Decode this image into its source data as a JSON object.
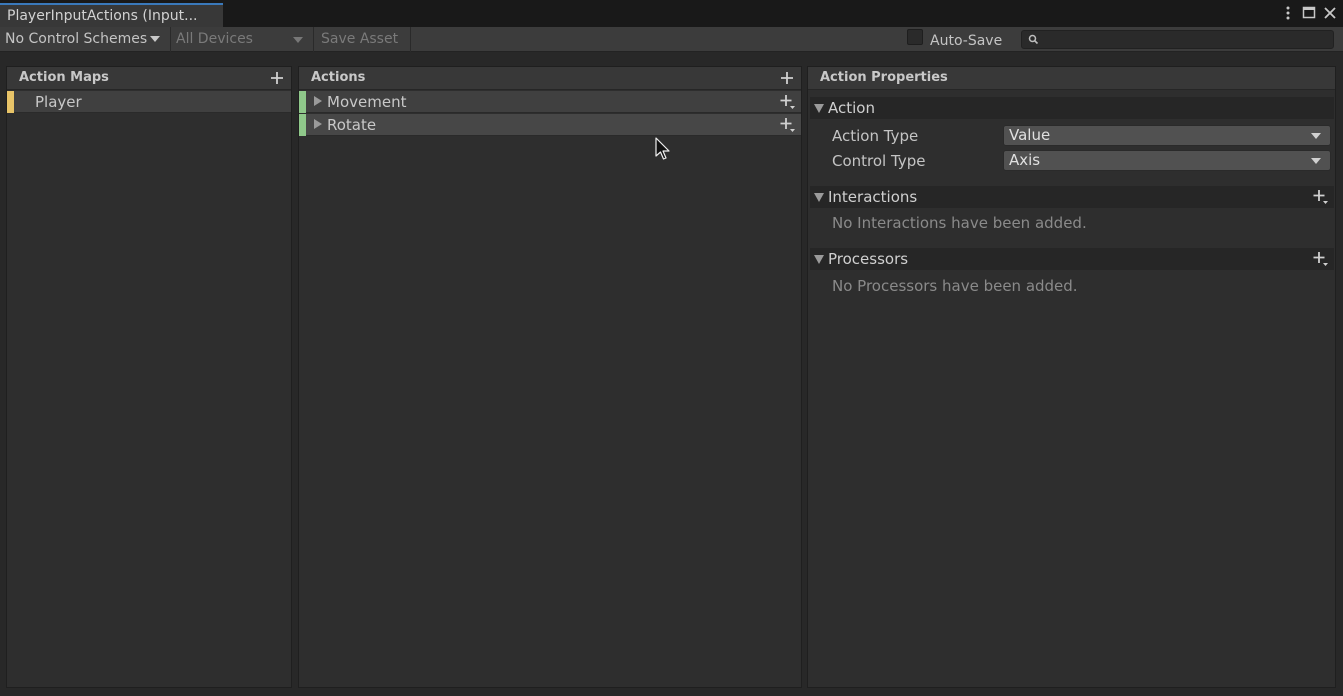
{
  "window": {
    "tab_title": "PlayerInputActions (Input...",
    "controls": {
      "more_icon": "more-vert-icon",
      "maximize_icon": "maximize-icon",
      "close_icon": "close-icon"
    }
  },
  "toolbar": {
    "control_schemes": "No Control Schemes",
    "devices": "All Devices",
    "save_asset": "Save Asset",
    "auto_save_label": "Auto-Save",
    "auto_save_checked": false,
    "search_placeholder": ""
  },
  "action_maps": {
    "title": "Action Maps",
    "items": [
      {
        "label": "Player",
        "color": "#e8c468"
      }
    ]
  },
  "actions": {
    "title": "Actions",
    "items": [
      {
        "label": "Movement",
        "color": "#8fc88a"
      },
      {
        "label": "Rotate",
        "color": "#8fc88a"
      }
    ]
  },
  "properties": {
    "title": "Action Properties",
    "action_section": "Action",
    "action_type_label": "Action Type",
    "action_type_value": "Value",
    "control_type_label": "Control Type",
    "control_type_value": "Axis",
    "interactions_section": "Interactions",
    "interactions_empty": "No Interactions have been added.",
    "processors_section": "Processors",
    "processors_empty": "No Processors have been added."
  },
  "colors": {
    "accent": "#3a79bb",
    "map_stripe": "#e8c468",
    "action_stripe": "#8fc88a"
  }
}
